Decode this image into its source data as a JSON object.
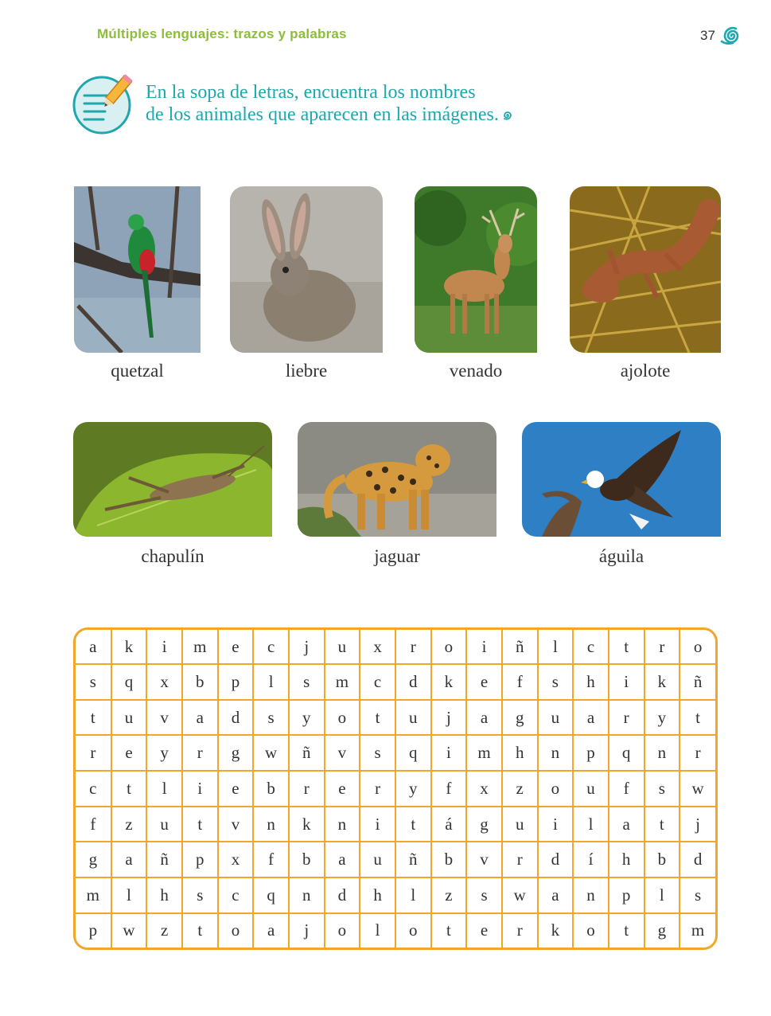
{
  "header": {
    "title": "Múltiples lenguajes: trazos y palabras",
    "page_number": "37"
  },
  "instruction": {
    "line1": "En la sopa de letras, encuentra los nombres",
    "line2": "de los animales que aparecen en las imágenes."
  },
  "animals": [
    {
      "name": "quetzal",
      "icon": "quetzal-photo"
    },
    {
      "name": "liebre",
      "icon": "hare-photo"
    },
    {
      "name": "venado",
      "icon": "deer-photo"
    },
    {
      "name": "ajolote",
      "icon": "axolotl-photo"
    },
    {
      "name": "chapulín",
      "icon": "grasshopper-photo"
    },
    {
      "name": "jaguar",
      "icon": "jaguar-photo"
    },
    {
      "name": "águila",
      "icon": "eagle-photo"
    }
  ],
  "word_search": [
    [
      "a",
      "k",
      "i",
      "m",
      "e",
      "c",
      "j",
      "u",
      "x",
      "r",
      "o",
      "i",
      "ñ",
      "l",
      "c",
      "t",
      "r",
      "o"
    ],
    [
      "s",
      "q",
      "x",
      "b",
      "p",
      "l",
      "s",
      "m",
      "c",
      "d",
      "k",
      "e",
      "f",
      "s",
      "h",
      "i",
      "k",
      "ñ"
    ],
    [
      "t",
      "u",
      "v",
      "a",
      "d",
      "s",
      "y",
      "o",
      "t",
      "u",
      "j",
      "a",
      "g",
      "u",
      "a",
      "r",
      "y",
      "t"
    ],
    [
      "r",
      "e",
      "y",
      "r",
      "g",
      "w",
      "ñ",
      "v",
      "s",
      "q",
      "i",
      "m",
      "h",
      "n",
      "p",
      "q",
      "n",
      "r"
    ],
    [
      "c",
      "t",
      "l",
      "i",
      "e",
      "b",
      "r",
      "e",
      "r",
      "y",
      "f",
      "x",
      "z",
      "o",
      "u",
      "f",
      "s",
      "w"
    ],
    [
      "f",
      "z",
      "u",
      "t",
      "v",
      "n",
      "k",
      "n",
      "i",
      "t",
      "á",
      "g",
      "u",
      "i",
      "l",
      "a",
      "t",
      "j"
    ],
    [
      "g",
      "a",
      "ñ",
      "p",
      "x",
      "f",
      "b",
      "a",
      "u",
      "ñ",
      "b",
      "v",
      "r",
      "d",
      "í",
      "h",
      "b",
      "d"
    ],
    [
      "m",
      "l",
      "h",
      "s",
      "c",
      "q",
      "n",
      "d",
      "h",
      "l",
      "z",
      "s",
      "w",
      "a",
      "n",
      "p",
      "l",
      "s"
    ],
    [
      "p",
      "w",
      "z",
      "t",
      "o",
      "a",
      "j",
      "o",
      "l",
      "o",
      "t",
      "e",
      "r",
      "k",
      "o",
      "t",
      "g",
      "m"
    ]
  ],
  "colors": {
    "header_green": "#8dbd3a",
    "instruction_teal": "#1fa6ae",
    "grid_orange": "#f2a72b"
  }
}
